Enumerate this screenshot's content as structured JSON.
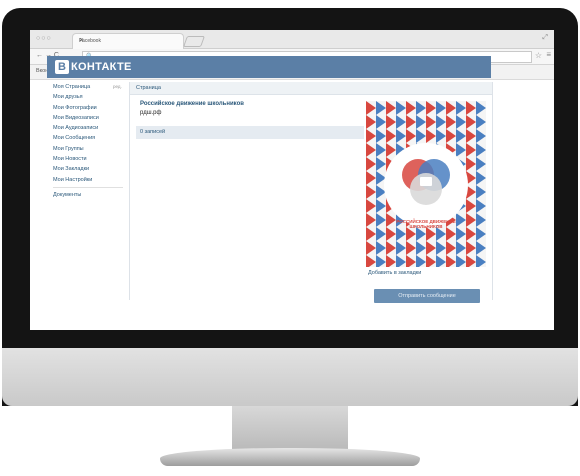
{
  "browser": {
    "tab_title": "Facebook",
    "tab_close": "✕",
    "window_control": "⤢",
    "nav_controls": "← → C",
    "url_icon": "🔍",
    "star_icon": "☆",
    "menu_icon": "≡",
    "bookmark_item": "Вконтакте"
  },
  "vk": {
    "logo_letter": "В",
    "logo_text": "КОНТАКТЕ",
    "sidebar": {
      "items": [
        {
          "label": "Моя Страница"
        },
        {
          "label": "Мои друзья"
        },
        {
          "label": "Мои Фотографии"
        },
        {
          "label": "Мои Видеозаписи"
        },
        {
          "label": "Мои Аудиозаписи"
        },
        {
          "label": "Мои Сообщения"
        },
        {
          "label": "Мои Группы"
        },
        {
          "label": "Мои Новости"
        },
        {
          "label": "Мои Закладки"
        },
        {
          "label": "Мои Настройки"
        }
      ],
      "edit_label": "ред.",
      "docs_label": "Документы"
    },
    "breadcrumb": "Страница",
    "page_name": "Российское движение школьников",
    "status": "рдш.рф",
    "wall_count": "0 записей",
    "avatar_caption": "РОССИЙСКОЕ ДВИЖЕНИЕ ШКОЛЬНИКОВ",
    "add_bookmark": "Добавить в закладки",
    "send_message": "Отправить сообщение"
  },
  "colors": {
    "vk_blue": "#5b7fa6",
    "link_blue": "#2b587a",
    "flag_red": "#d8473f",
    "flag_blue": "#4a7fc1"
  }
}
